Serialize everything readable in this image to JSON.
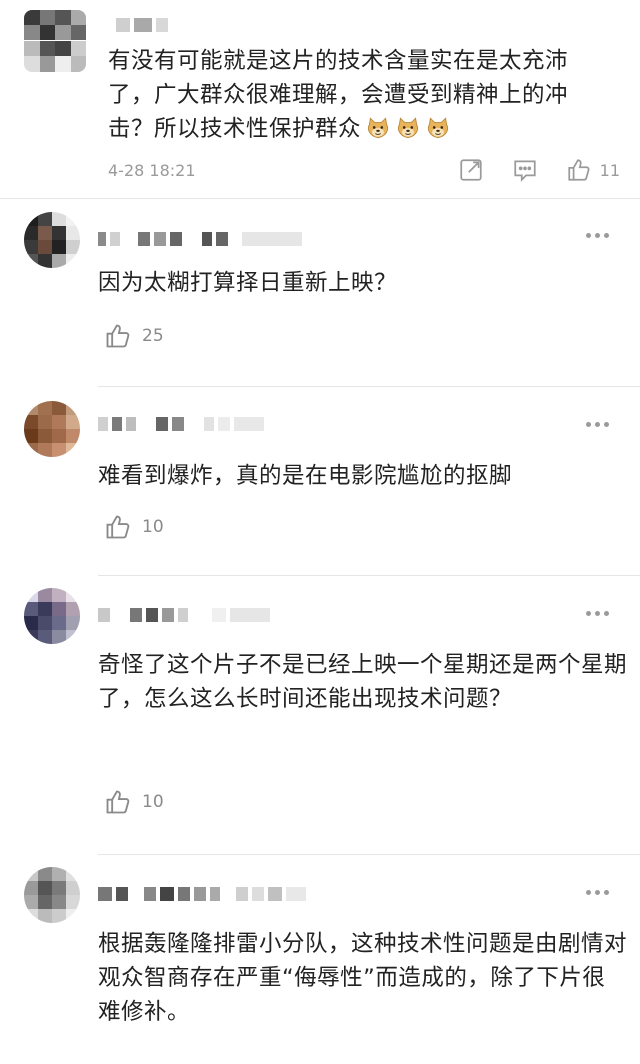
{
  "comments": [
    {
      "text": "有没有可能就是这片的技术含量实在是太充沛了，广大群众很难理解，会遭受到精神上的冲击？所以技术性保护群众",
      "emoji": "doge-emoji",
      "emoji_count": 3,
      "date": "4-28 18:21",
      "likes": "11"
    },
    {
      "text": "因为太糊打算择日重新上映？",
      "likes": "25"
    },
    {
      "text": "难看到爆炸，真的是在电影院尴尬的抠脚",
      "likes": "10"
    },
    {
      "text": "奇怪了这个片子不是已经上映一个星期还是两个星期了，怎么这么长时间还能出现技术问题？",
      "likes": "10"
    },
    {
      "text": "根据轰隆隆排雷小分队，这种技术性问题是由剧情对观众智商存在严重“侮辱性”而造成的，除了下片很难修补。"
    }
  ],
  "colors": {
    "text": "#222222",
    "meta": "#9a9a9a",
    "divider": "#e6e6e6"
  },
  "icons": [
    "share-icon",
    "comment-icon",
    "thumbs-up-icon",
    "more-options-icon"
  ]
}
